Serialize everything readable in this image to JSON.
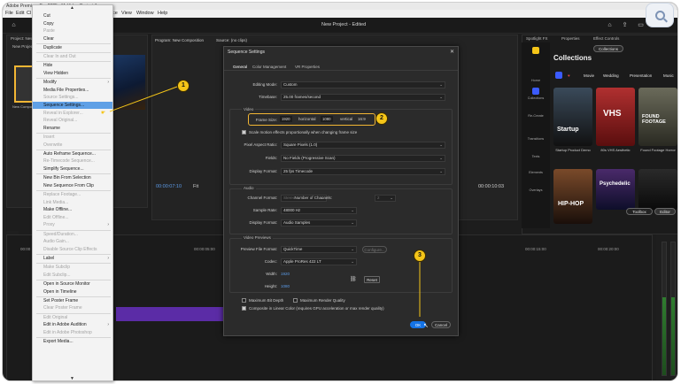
{
  "app": {
    "titlebar": "Adobe Premiere Pro 2025 - MyVideo Project 1",
    "menus": [
      "File",
      "Edit",
      "Cl",
      "ce",
      "View",
      "Window",
      "Help"
    ],
    "project_title": "New Project - Edited"
  },
  "panels": {
    "project_tab": "Project: New P",
    "program_tab": "Program: New Composition",
    "source_tab": "Source: (no clips)",
    "spotlight_tab": "Spotlight FX",
    "properties_tab": "Properties",
    "effect_controls_tab": "Effect Controls",
    "project_item": "New Project",
    "items_selected": "1 items selected",
    "thumb_label": "New Composition"
  },
  "context_menu": {
    "items": [
      {
        "label": "Cut",
        "disabled": false
      },
      {
        "label": "Copy",
        "disabled": false
      },
      {
        "label": "Paste",
        "disabled": true
      },
      {
        "label": "Clear",
        "disabled": false
      },
      {
        "label": "Duplicate",
        "disabled": false
      },
      {
        "label": "Clear In and Out",
        "disabled": true
      },
      {
        "label": "Hide",
        "disabled": false
      },
      {
        "label": "View Hidden",
        "disabled": false
      },
      {
        "label": "Modify",
        "disabled": false,
        "submenu": true
      },
      {
        "label": "Media File Properties...",
        "disabled": false
      },
      {
        "label": "Source Settings...",
        "disabled": true
      },
      {
        "label": "Sequence Settings...",
        "disabled": false,
        "highlight": true
      },
      {
        "label": "Reveal in Explorer...",
        "disabled": true
      },
      {
        "label": "Reveal Original...",
        "disabled": true
      },
      {
        "label": "Rename",
        "disabled": false
      },
      {
        "label": "Insert",
        "disabled": true
      },
      {
        "label": "Overwrite",
        "disabled": true
      },
      {
        "label": "Auto Reframe Sequence...",
        "disabled": false
      },
      {
        "label": "Re-Timecode Sequence...",
        "disabled": true
      },
      {
        "label": "Simplify Sequence...",
        "disabled": false
      },
      {
        "label": "New Bin From Selection",
        "disabled": false
      },
      {
        "label": "New Sequence From Clip",
        "disabled": false
      },
      {
        "label": "Replace Footage...",
        "disabled": true
      },
      {
        "label": "Link Media...",
        "disabled": true
      },
      {
        "label": "Make Offline...",
        "disabled": false
      },
      {
        "label": "Edit Offline...",
        "disabled": true
      },
      {
        "label": "Proxy",
        "disabled": true,
        "submenu": true
      },
      {
        "label": "Speed/Duration...",
        "disabled": true
      },
      {
        "label": "Audio Gain...",
        "disabled": true
      },
      {
        "label": "Disable Source Clip Effects",
        "disabled": true
      },
      {
        "label": "Label",
        "disabled": false,
        "submenu": true
      },
      {
        "label": "Make Subclip",
        "disabled": true
      },
      {
        "label": "Edit Subclip...",
        "disabled": true
      },
      {
        "label": "Open in Source Monitor",
        "disabled": false
      },
      {
        "label": "Open in Timeline",
        "disabled": false
      },
      {
        "label": "Set Poster Frame",
        "disabled": false
      },
      {
        "label": "Clear Poster Frame",
        "disabled": true
      },
      {
        "label": "Edit Original",
        "disabled": true
      },
      {
        "label": "Edit in Adobe Audition",
        "disabled": false,
        "submenu": true
      },
      {
        "label": "Edit in Adobe Photoshop",
        "disabled": true
      },
      {
        "label": "Export Media...",
        "disabled": false
      }
    ]
  },
  "dialog": {
    "title": "Sequence Settings",
    "tabs": [
      "General",
      "Color Management",
      "VR Properties"
    ],
    "editing_mode_label": "Editing Mode:",
    "editing_mode": "Custom",
    "timebase_label": "Timebase:",
    "timebase": "25.00 frames/second",
    "video_group": "Video",
    "frame_size_label": "Frame Size:",
    "frame_w": "1920",
    "horizontal": "horizontal",
    "frame_h": "1080",
    "vertical": "vertical",
    "aspect": "16:9",
    "scale_motion": "Scale motion effects proportionally when changing frame size",
    "pixel_aspect_label": "Pixel Aspect Ratio:",
    "pixel_aspect": "Square Pixels (1.0)",
    "fields_label": "Fields:",
    "fields": "No Fields (Progressive Scan)",
    "display_format_label": "Display Format:",
    "display_format": "25 fps Timecode",
    "audio_group": "Audio",
    "channel_format_label": "Channel Format:",
    "channel_format": "Stereo",
    "num_channels_label": "Number of Channels:",
    "num_channels": "2",
    "sample_rate_label": "Sample Rate:",
    "sample_rate": "48000 Hz",
    "audio_display_label": "Display Format:",
    "audio_display": "Audio Samples",
    "preview_group": "Video Previews",
    "preview_format_label": "Preview File Format:",
    "preview_format": "QuickTime",
    "configure": "Configure...",
    "codec_label": "Codec:",
    "codec": "Apple ProRes 422 LT",
    "width_label": "Width:",
    "width": "1920",
    "height_label": "Height:",
    "height": "1080",
    "reset": "Reset",
    "max_bit_depth": "Maximum Bit Depth",
    "max_render_quality": "Maximum Render Quality",
    "composite_linear": "Composite in Linear Color (requires GPU acceleration or max render quality)",
    "ok": "OK",
    "cancel": "Cancel"
  },
  "monitor": {
    "timecode_left": "00:00:07:10",
    "fit": "Fit",
    "timecode_right": "00:00:10:03"
  },
  "timeline": {
    "ruler": [
      "00:00",
      "00:00:05:00",
      "00:00:10:00",
      "00:00:15:00",
      "00:00:20:00"
    ]
  },
  "spotlight": {
    "collections_btn": "Collections",
    "heading": "Collections",
    "nav": [
      "Home",
      "Collections",
      "Re-Create",
      "Transitions",
      "Texts",
      "Elements",
      "Overlays"
    ],
    "categories": [
      "Movie",
      "Wedding",
      "Presentation",
      "Music"
    ],
    "cards": [
      {
        "title": "Startup",
        "label": "Startup Product Demo"
      },
      {
        "title": "VHS",
        "label": "80s VHS Aesthetic"
      },
      {
        "title": "FOUND FOOTAGE",
        "label": "Found Footage Horror"
      },
      {
        "title": "HIP-HOP",
        "label": ""
      },
      {
        "title": "Psychedelic",
        "label": ""
      },
      {
        "title": "",
        "label": ""
      }
    ],
    "toolbox": "Toolbox",
    "editor": "Editor"
  },
  "callouts": [
    "1",
    "2",
    "3"
  ],
  "colors": {
    "accent": "#1473e6",
    "callout": "#f5c518",
    "highlight": "#5fa0e6",
    "clip": "#5b2ca6"
  }
}
